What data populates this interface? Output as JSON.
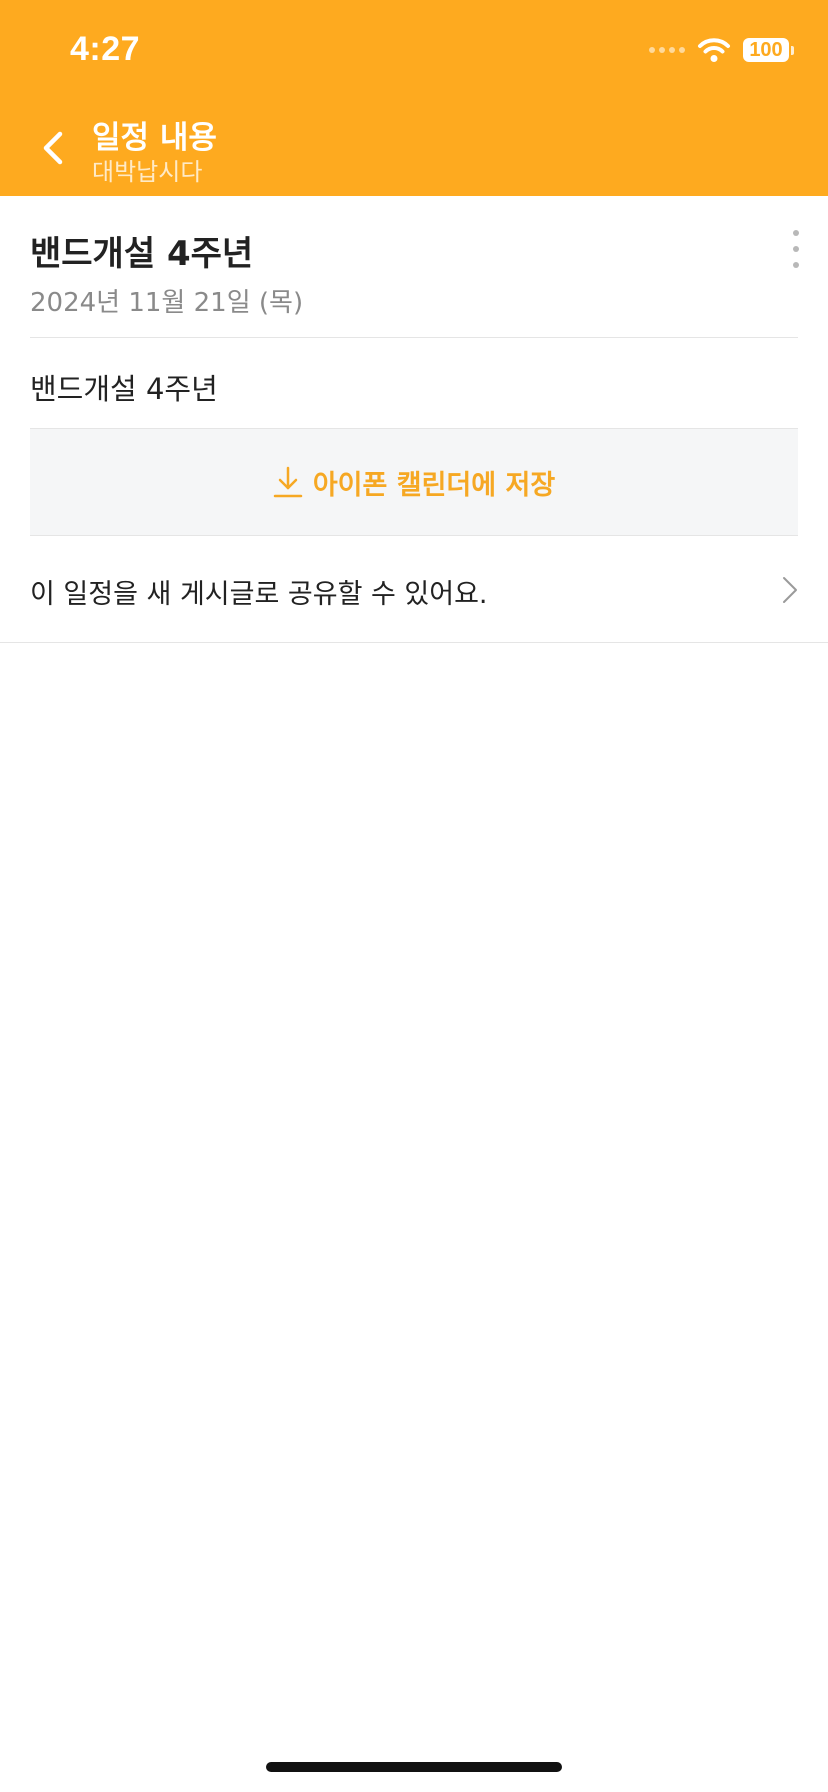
{
  "status_bar": {
    "time": "4:27",
    "battery": "100"
  },
  "nav": {
    "title": "일정 내용",
    "subtitle": "대박납시다",
    "back_icon": "chevron-left-icon",
    "background_color": "#FEAA1F"
  },
  "event": {
    "title": "밴드개설 4주년",
    "date": "2024년 11월 21일 (목)",
    "body": "밴드개설 4주년",
    "more_icon": "more-vertical-icon"
  },
  "actions": {
    "save_calendar_label": "아이폰 캘린더에 저장",
    "save_icon": "download-icon",
    "accent_color": "#F6A823",
    "share_text": "이 일정을 새 게시글로 공유할 수 있어요.",
    "share_icon": "chevron-right-icon"
  }
}
